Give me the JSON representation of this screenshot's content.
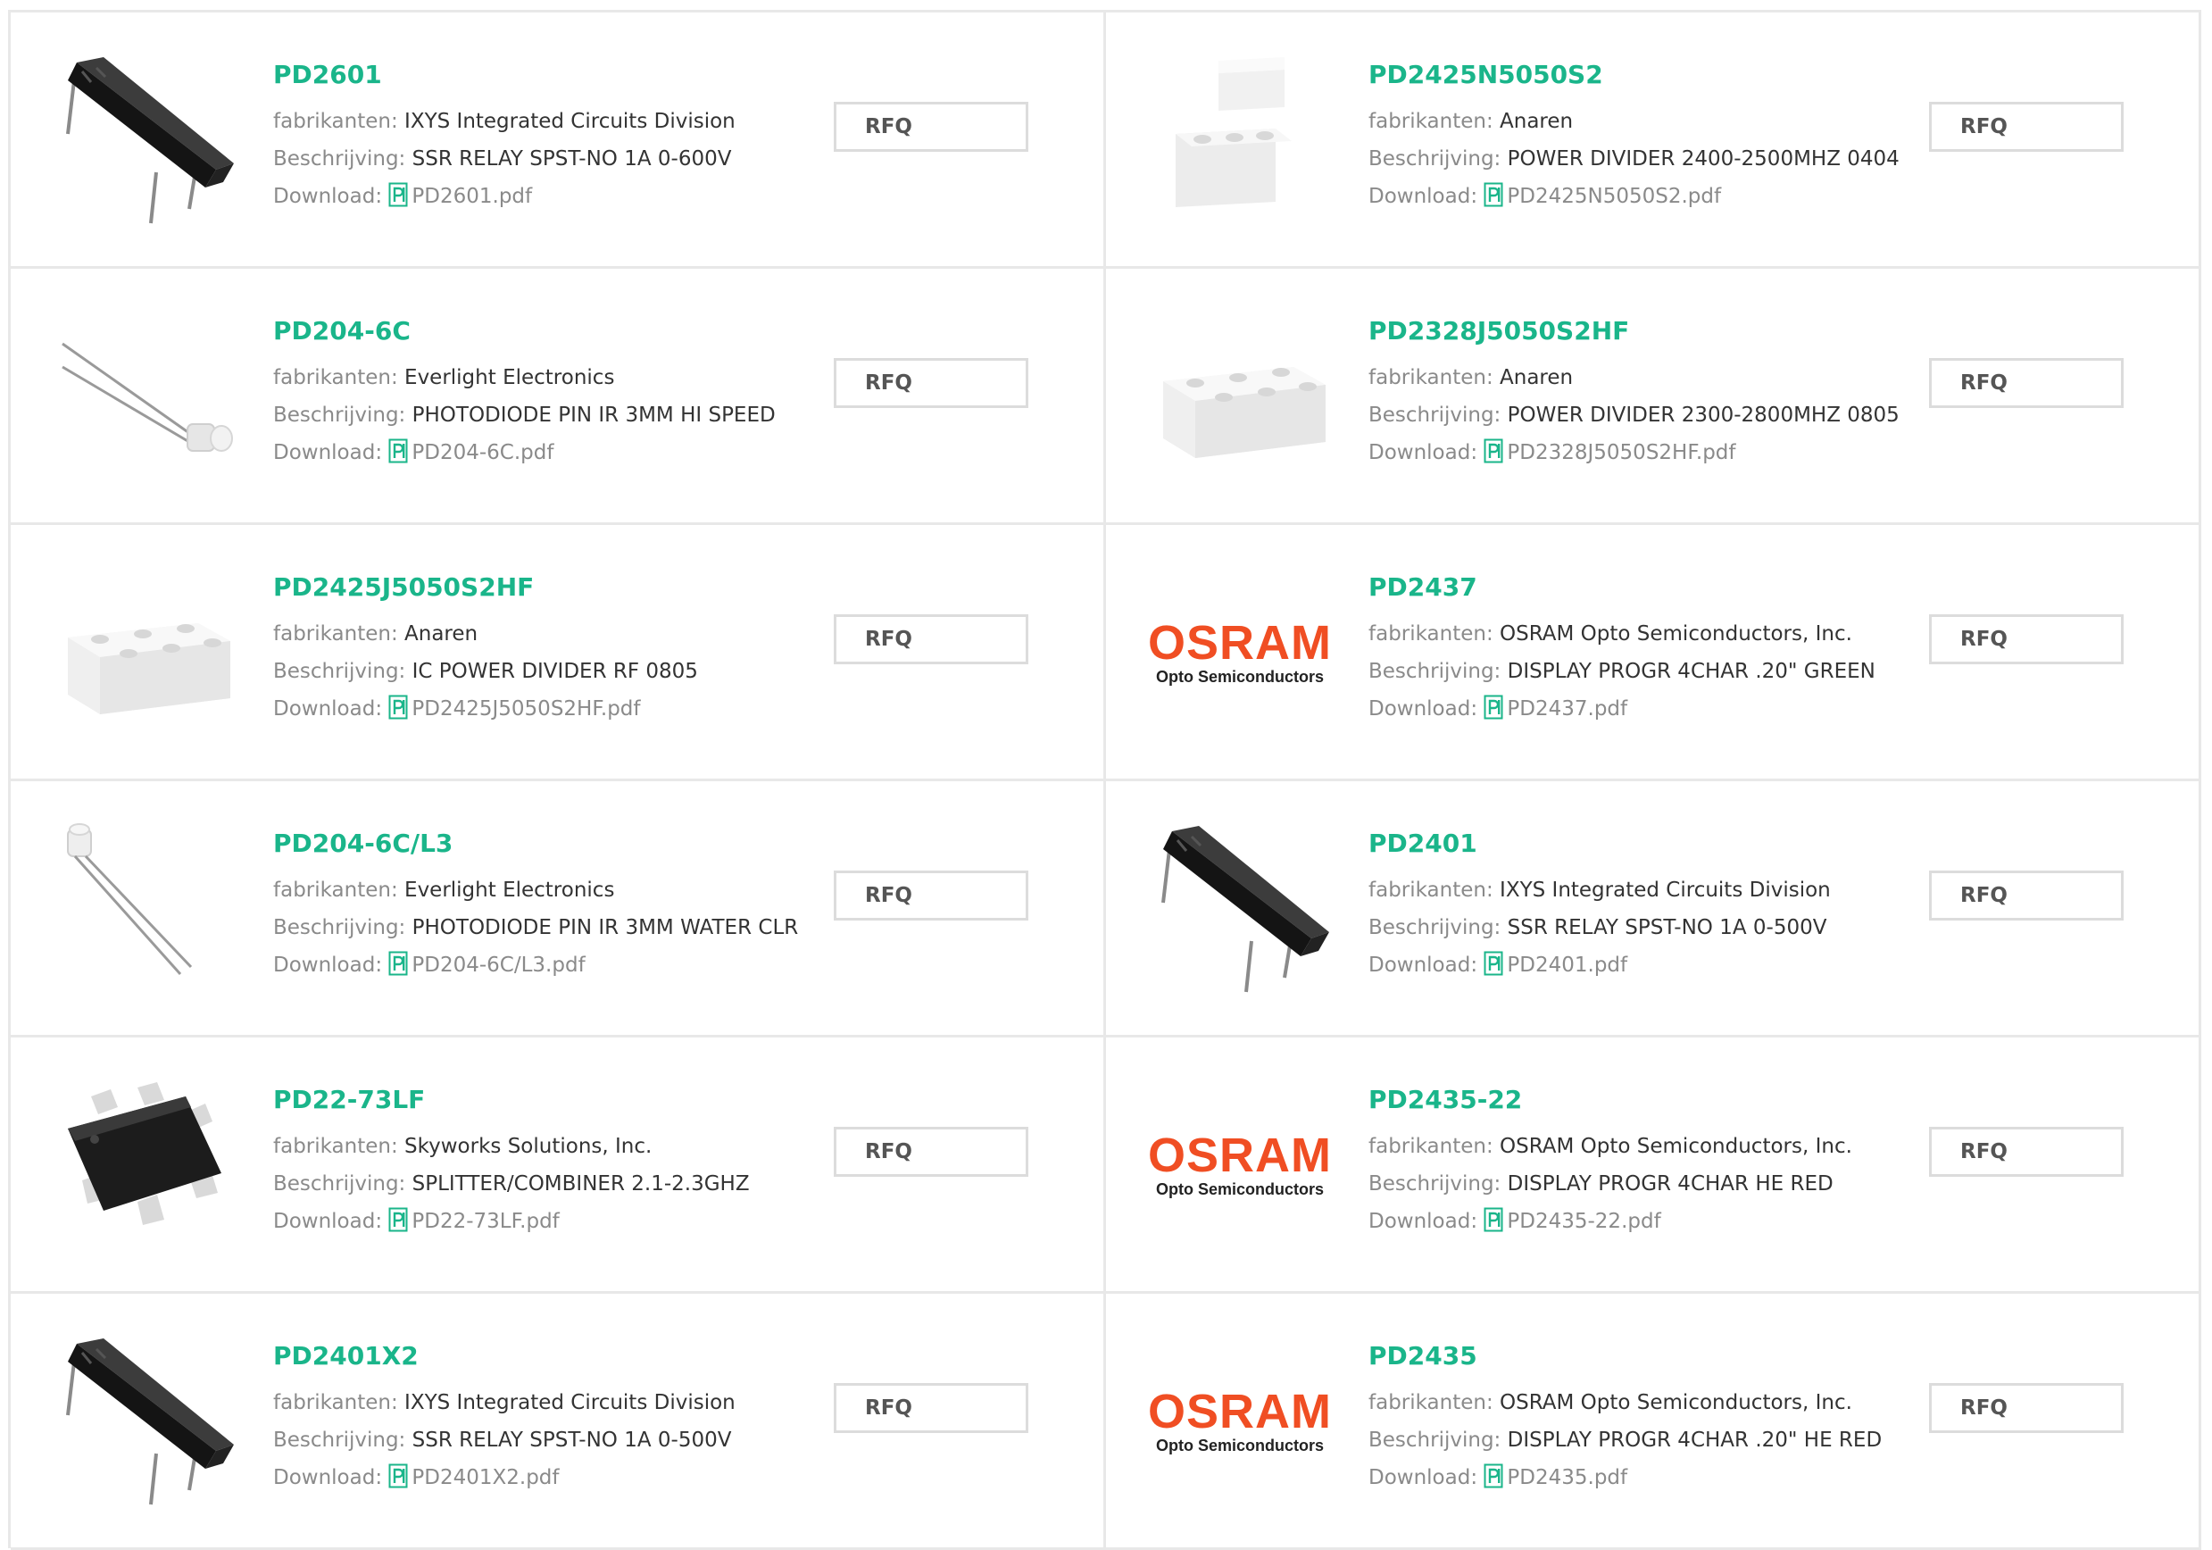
{
  "labels": {
    "manufacturer": "fabrikanten:",
    "description": "Beschrijving:",
    "download": "Download:",
    "rfq": "RFQ"
  },
  "colors": {
    "part_link": "#1ab58a",
    "border": "#e8e8e8",
    "osram_orange": "#f04e23"
  },
  "products": [
    {
      "part": "PD2601",
      "manufacturer": "IXYS Integrated Circuits Division",
      "description": "SSR RELAY SPST-NO 1A 0-600V",
      "file": "PD2601.pdf",
      "image": "dip-relay-icon"
    },
    {
      "part": "PD2425N5050S2",
      "manufacturer": "Anaren",
      "description": "POWER DIVIDER 2400-2500MHZ 0404",
      "file": "PD2425N5050S2.pdf",
      "image": "chip-cube-icon"
    },
    {
      "part": "PD204-6C",
      "manufacturer": "Everlight Electronics",
      "description": "PHOTODIODE PIN IR 3MM HI SPEED",
      "file": "PD204-6C.pdf",
      "image": "photodiode-horizontal-icon"
    },
    {
      "part": "PD2328J5050S2HF",
      "manufacturer": "Anaren",
      "description": "POWER DIVIDER 2300-2800MHZ 0805",
      "file": "PD2328J5050S2HF.pdf",
      "image": "smd-block-icon"
    },
    {
      "part": "PD2425J5050S2HF",
      "manufacturer": "Anaren",
      "description": "IC POWER DIVIDER RF 0805",
      "file": "PD2425J5050S2HF.pdf",
      "image": "smd-block-icon"
    },
    {
      "part": "PD2437",
      "manufacturer": "OSRAM Opto Semiconductors, Inc.",
      "description": "DISPLAY PROGR 4CHAR .20\" GREEN",
      "file": "PD2437.pdf",
      "image": "osram-logo",
      "logo_word": "OSRAM",
      "logo_sub": "Opto Semiconductors"
    },
    {
      "part": "PD204-6C/L3",
      "manufacturer": "Everlight Electronics",
      "description": "PHOTODIODE PIN IR 3MM WATER CLR",
      "file": "PD204-6C/L3.pdf",
      "image": "photodiode-vertical-icon"
    },
    {
      "part": "PD2401",
      "manufacturer": "IXYS Integrated Circuits Division",
      "description": "SSR RELAY SPST-NO 1A 0-500V",
      "file": "PD2401.pdf",
      "image": "dip-relay-icon"
    },
    {
      "part": "PD22-73LF",
      "manufacturer": "Skyworks Solutions, Inc.",
      "description": "SPLITTER/COMBINER 2.1-2.3GHZ",
      "file": "PD22-73LF.pdf",
      "image": "sot-ic-icon"
    },
    {
      "part": "PD2435-22",
      "manufacturer": "OSRAM Opto Semiconductors, Inc.",
      "description": "DISPLAY PROGR 4CHAR HE RED",
      "file": "PD2435-22.pdf",
      "image": "osram-logo",
      "logo_word": "OSRAM",
      "logo_sub": "Opto Semiconductors"
    },
    {
      "part": "PD2401X2",
      "manufacturer": "IXYS Integrated Circuits Division",
      "description": "SSR RELAY SPST-NO 1A 0-500V",
      "file": "PD2401X2.pdf",
      "image": "dip-relay-icon"
    },
    {
      "part": "PD2435",
      "manufacturer": "OSRAM Opto Semiconductors, Inc.",
      "description": "DISPLAY PROGR 4CHAR .20\" HE RED",
      "file": "PD2435.pdf",
      "image": "osram-logo",
      "logo_word": "OSRAM",
      "logo_sub": "Opto Semiconductors"
    }
  ]
}
